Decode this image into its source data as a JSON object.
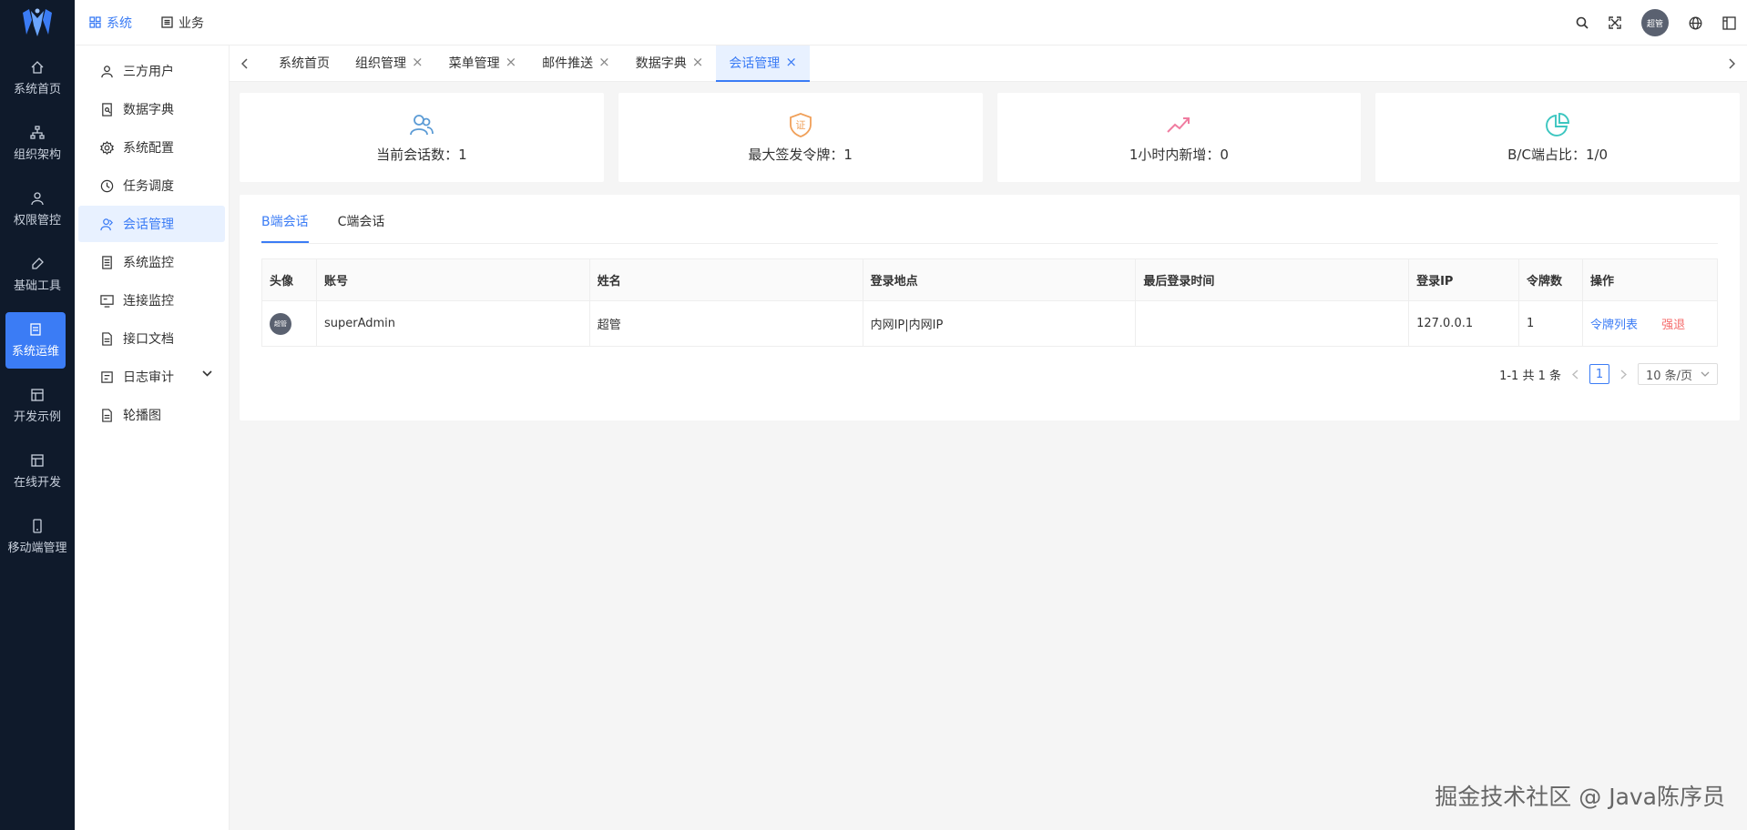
{
  "colors": {
    "rail_bg": "#0f1a2b",
    "accent": "#3b7cf5",
    "danger": "#f56c6c"
  },
  "rail": [
    {
      "label": "系统首页",
      "icon": "home-icon"
    },
    {
      "label": "组织架构",
      "icon": "org-icon"
    },
    {
      "label": "权限管控",
      "icon": "user-icon"
    },
    {
      "label": "基础工具",
      "icon": "tool-icon"
    },
    {
      "label": "系统运维",
      "icon": "server-icon",
      "active": true
    },
    {
      "label": "开发示例",
      "icon": "grid-icon"
    },
    {
      "label": "在线开发",
      "icon": "grid-icon"
    },
    {
      "label": "移动端管理",
      "icon": "mobile-icon"
    }
  ],
  "topbar": {
    "tabs": [
      {
        "label": "系统",
        "active": true
      },
      {
        "label": "业务"
      }
    ],
    "avatar_text": "超管"
  },
  "sidebar": [
    {
      "label": "三方用户",
      "icon": "user-icon"
    },
    {
      "label": "数据字典",
      "icon": "dict-icon"
    },
    {
      "label": "系统配置",
      "icon": "gear-icon"
    },
    {
      "label": "任务调度",
      "icon": "clock-icon"
    },
    {
      "label": "会话管理",
      "icon": "session-icon",
      "active": true
    },
    {
      "label": "系统监控",
      "icon": "monitor-icon"
    },
    {
      "label": "连接监控",
      "icon": "screen-icon"
    },
    {
      "label": "接口文档",
      "icon": "doc-icon"
    },
    {
      "label": "日志审计",
      "icon": "log-icon",
      "expandable": true
    },
    {
      "label": "轮播图",
      "icon": "doc-icon"
    }
  ],
  "page_tabs": [
    {
      "label": "系统首页",
      "closable": false
    },
    {
      "label": "组织管理",
      "closable": true
    },
    {
      "label": "菜单管理",
      "closable": true
    },
    {
      "label": "邮件推送",
      "closable": true
    },
    {
      "label": "数据字典",
      "closable": true
    },
    {
      "label": "会话管理",
      "closable": true,
      "active": true
    }
  ],
  "cards": [
    {
      "label": "当前会话数：1",
      "icon": "users-icon",
      "color": "#5b9bd5"
    },
    {
      "label": "最大签发令牌：1",
      "icon": "certificate-icon",
      "color": "#f0a05a"
    },
    {
      "label": "1小时内新增：0",
      "icon": "trend-up-icon",
      "color": "#f07ca0"
    },
    {
      "label": "B/C端占比：1/0",
      "icon": "pie-chart-icon",
      "color": "#3cc6c0"
    }
  ],
  "subtabs": [
    {
      "label": "B端会话",
      "active": true
    },
    {
      "label": "C端会话"
    }
  ],
  "table": {
    "columns": [
      "头像",
      "账号",
      "姓名",
      "登录地点",
      "最后登录时间",
      "登录IP",
      "令牌数",
      "操作"
    ],
    "rows": [
      {
        "avatar_text": "超管",
        "account": "superAdmin",
        "name": "超管",
        "location": "内网IP|内网IP",
        "last_login": "",
        "ip": "127.0.0.1",
        "tokens": "1",
        "action_list": "令牌列表",
        "action_kick": "强退"
      }
    ]
  },
  "pager": {
    "summary": "1-1 共 1 条",
    "current": "1",
    "size": "10 条/页"
  },
  "watermark": "掘金技术社区 @ Java陈序员"
}
